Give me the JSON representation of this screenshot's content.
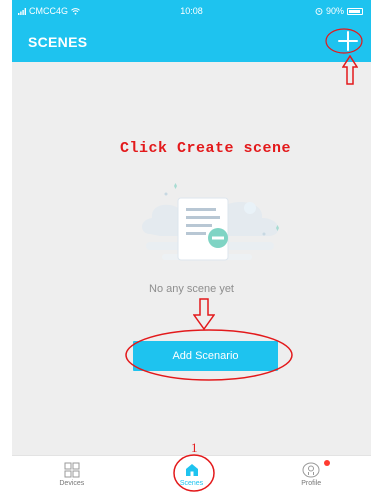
{
  "status_bar": {
    "carrier": "CMCC4G",
    "time": "10:08",
    "battery": "90%"
  },
  "header": {
    "title": "SCENES"
  },
  "annotations": {
    "click_hint": "Click Create scene",
    "step_number": "1"
  },
  "main": {
    "empty_message": "No any scene yet",
    "add_button_label": "Add Scenario"
  },
  "tabbar": {
    "tabs": [
      {
        "label": "Devices"
      },
      {
        "label": "Scenes"
      },
      {
        "label": "Profile"
      }
    ]
  },
  "colors": {
    "accent": "#1ec3ef",
    "annotation": "#e3191b",
    "background": "#eeeeee"
  }
}
